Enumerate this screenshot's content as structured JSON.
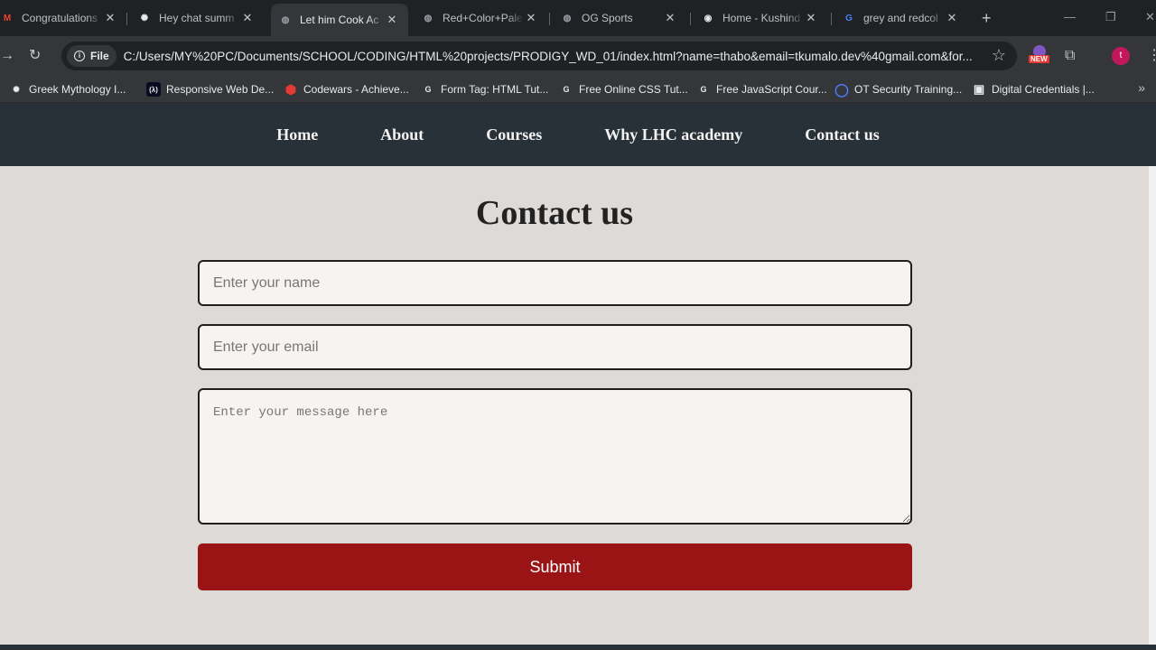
{
  "browser": {
    "tabs": [
      {
        "title": "Congratulations",
        "icon": "gmail-icon",
        "glyph": "M",
        "color": "#ea4335"
      },
      {
        "title": "Hey chat summ",
        "icon": "chatgpt-icon",
        "glyph": "✺",
        "color": "#e8eaed"
      },
      {
        "title": "Let him Cook Ac",
        "icon": "globe-icon",
        "glyph": "◍",
        "color": "#9aa0a6",
        "active": true
      },
      {
        "title": "Red+Color+Pale",
        "icon": "globe-icon",
        "glyph": "◍",
        "color": "#9aa0a6"
      },
      {
        "title": "OG Sports",
        "icon": "globe-icon",
        "glyph": "◍",
        "color": "#9aa0a6"
      },
      {
        "title": "Home - Kushind",
        "icon": "site-icon",
        "glyph": "◉",
        "color": "#e8eaed"
      },
      {
        "title": "grey and redcol",
        "icon": "google-icon",
        "glyph": "G",
        "color": "#4285f4"
      }
    ],
    "omnibox": {
      "chip_label": "File",
      "url": "C:/Users/MY%20PC/Documents/SCHOOL/CODING/HTML%20projects/PRODIGY_WD_01/index.html?name=thabo&email=tkumalo.dev%40gmail.com&for..."
    },
    "extension_badge": "NEW",
    "profile_initial": "t",
    "bookmarks": [
      {
        "label": "Greek Mythology I...",
        "icon": "chatgpt-icon",
        "glyph": "✺",
        "color": "#e8eaed",
        "bg": "transparent"
      },
      {
        "label": "Responsive Web De...",
        "icon": "freecodecamp-icon",
        "glyph": "(λ)",
        "color": "#e8eaed",
        "bg": "#0a0a23"
      },
      {
        "label": "Codewars - Achieve...",
        "icon": "codewars-icon",
        "glyph": "⬢",
        "color": "#e53935",
        "bg": "transparent"
      },
      {
        "label": "Form Tag: HTML Tut...",
        "icon": "google-icon",
        "glyph": "G",
        "color": "#e8eaed",
        "bg": "transparent"
      },
      {
        "label": "Free Online CSS Tut...",
        "icon": "google-icon",
        "glyph": "G",
        "color": "#e8eaed",
        "bg": "transparent"
      },
      {
        "label": "Free JavaScript Cour...",
        "icon": "google-icon",
        "glyph": "G",
        "color": "#e8eaed",
        "bg": "transparent"
      },
      {
        "label": "OT Security Training...",
        "icon": "ring-icon",
        "glyph": "◯",
        "color": "#4f7dff",
        "bg": "transparent"
      },
      {
        "label": "Digital Credentials |...",
        "icon": "credential-icon",
        "glyph": "▣",
        "color": "#e8eaed",
        "bg": "transparent"
      }
    ]
  },
  "site": {
    "nav": [
      "Home",
      "About",
      "Courses",
      "Why LHC academy",
      "Contact us"
    ],
    "heading": "Contact us",
    "form": {
      "name_placeholder": "Enter your name",
      "email_placeholder": "Enter your email",
      "message_placeholder": "Enter your message here",
      "submit_label": "Submit"
    }
  },
  "colors": {
    "nav_bg": "#283038",
    "page_bg": "#dedad8",
    "submit_bg": "#9a1315"
  }
}
